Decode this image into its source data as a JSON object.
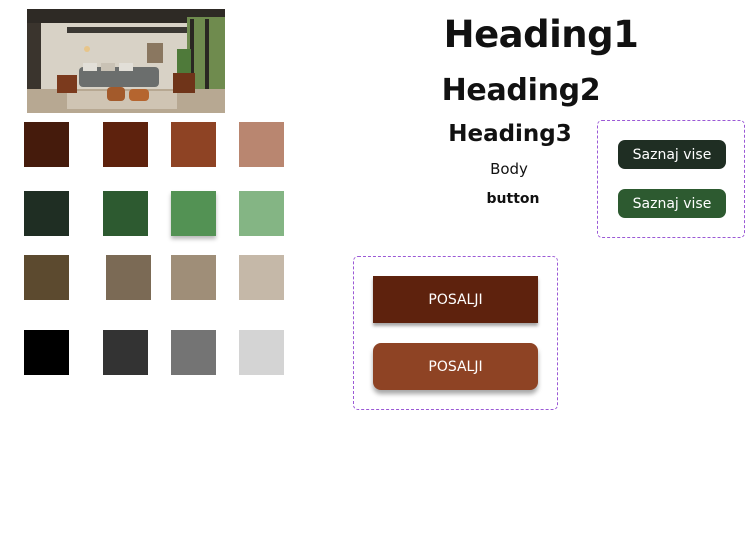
{
  "image": {
    "alt": "living room photo"
  },
  "palette": {
    "rows": [
      [
        "#451b0c",
        "#5e220d",
        "#8e4324",
        "#b98670"
      ],
      [
        "#1f2e23",
        "#2d5a30",
        "#539254",
        "#84b584"
      ],
      [
        "#5c4a2f",
        "#7b6a55",
        "#9f8e78",
        "#c5b8a8"
      ],
      [
        "#000000",
        "#333333",
        "#747474",
        "#d4d4d4"
      ]
    ]
  },
  "typography": {
    "heading1": "Heading1",
    "heading2": "Heading2",
    "heading3": "Heading3",
    "body": "Body",
    "button": "button"
  },
  "pill_buttons": {
    "dark_label": "Saznaj vise",
    "green_label": "Saznaj vise"
  },
  "submit_buttons": {
    "square_label": "POSALJI",
    "rounded_label": "POSALJI"
  }
}
